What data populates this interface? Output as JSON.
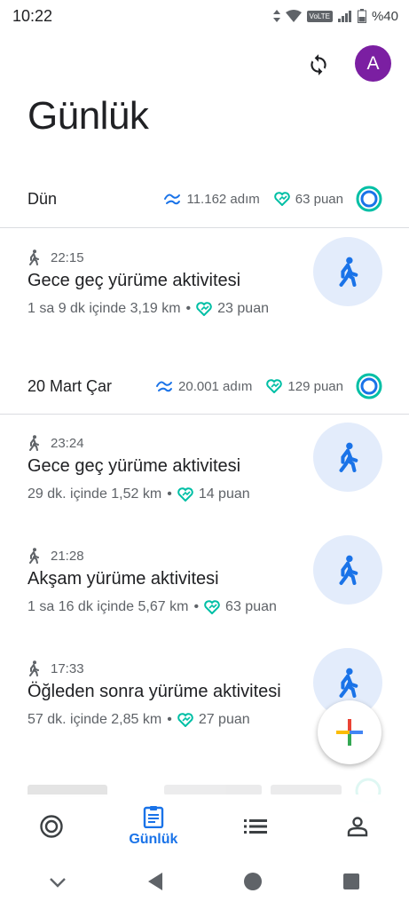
{
  "status_bar": {
    "time": "10:22",
    "network_badge": "VoLTE",
    "battery": "%40"
  },
  "header": {
    "title": "Günlük",
    "avatar_letter": "A",
    "avatar_color": "#7b1fa2"
  },
  "days": [
    {
      "label": "Dün",
      "steps": "11.162 adım",
      "points": "63 puan",
      "activities": [
        {
          "time": "22:15",
          "title": "Gece geç yürüme aktivitesi",
          "summary": "1 sa 9 dk içinde 3,19 km",
          "points": "23 puan"
        }
      ]
    },
    {
      "label": "20 Mart Çar",
      "steps": "20.001 adım",
      "points": "129 puan",
      "activities": [
        {
          "time": "23:24",
          "title": "Gece geç yürüme aktivitesi",
          "summary": "29 dk. içinde 1,52 km",
          "points": "14 puan"
        },
        {
          "time": "21:28",
          "title": "Akşam yürüme aktivitesi",
          "summary": "1 sa 16 dk içinde 5,67 km",
          "points": "63 puan"
        },
        {
          "time": "17:33",
          "title": "Öğleden sonra yürüme aktivitesi",
          "summary": "57 dk. içinde 2,85 km",
          "points": "27 puan"
        }
      ]
    }
  ],
  "bottom_nav": {
    "active_label": "Günlük"
  },
  "colors": {
    "accent": "#1a73e8",
    "ring": "#00897b",
    "heart": "#00bfa5",
    "activity_bg": "#e3ecfb"
  }
}
